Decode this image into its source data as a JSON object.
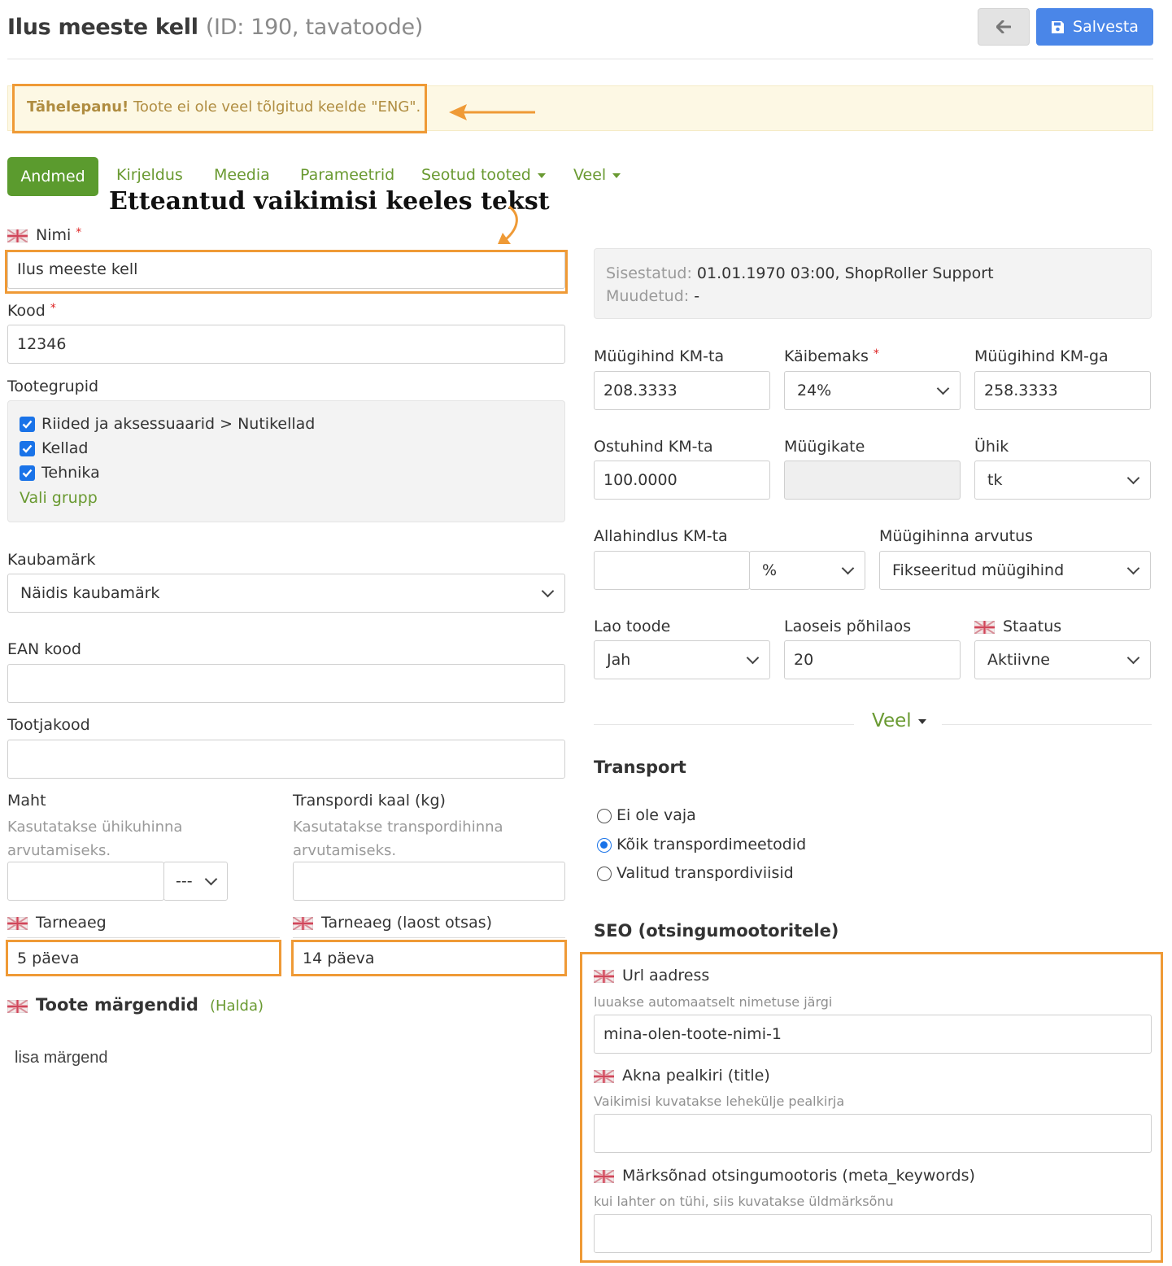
{
  "header": {
    "title": "Ilus meeste kell",
    "subtitle": "(ID: 190, tavatoode)",
    "save_label": "Salvesta"
  },
  "alert": {
    "strong": "Tähelepanu!",
    "text": " Toote ei ole veel tõlgitud keelde \"ENG\"."
  },
  "tabs": [
    {
      "label": "Andmed"
    },
    {
      "label": "Kirjeldus"
    },
    {
      "label": "Meedia"
    },
    {
      "label": "Parameetrid"
    },
    {
      "label": "Seotud tooted"
    },
    {
      "label": "Veel"
    }
  ],
  "annotation": "Etteantud vaikimisi keeles tekst",
  "left": {
    "name_label": "Nimi",
    "name_value": "Ilus meeste kell",
    "code_label": "Kood",
    "code_value": "12346",
    "groups_label": "Tootegrupid",
    "groups": [
      "Riided ja aksessuaarid > Nutikellad",
      "Kellad",
      "Tehnika"
    ],
    "choose_group": "Vali grupp",
    "brand_label": "Kaubamärk",
    "brand_value": "Näidis kaubamärk",
    "ean_label": "EAN kood",
    "ean_value": "",
    "maker_label": "Tootjakood",
    "maker_value": "",
    "volume_label": "Maht",
    "volume_hint": "Kasutatakse ühikuhinna arvutamiseks.",
    "volume_unit": "---",
    "weight_label": "Transpordi kaal (kg)",
    "weight_hint": "Kasutatakse transpordihinna arvutamiseks.",
    "delivery_label": "Tarneaeg",
    "delivery_value": "5 päeva",
    "delivery_stock_label": "Tarneaeg (laost otsas)",
    "delivery_stock_value": "14 päeva",
    "tags_title": "Toote märgendid",
    "tags_manage": "(Halda)",
    "add_tag": "lisa märgend"
  },
  "right": {
    "info_created_label": "Sisestatud:",
    "info_created_value": " 01.01.1970 03:00, ShopRoller Support",
    "info_modified_label": "Muudetud:",
    "info_modified_value": " -",
    "price_excl_label": "Müügihind KM-ta",
    "price_excl_value": "208.3333",
    "vat_label": "Käibemaks",
    "vat_value": "24%",
    "price_incl_label": "Müügihind KM-ga",
    "price_incl_value": "258.3333",
    "purchase_label": "Ostuhind KM-ta",
    "purchase_value": "100.0000",
    "margin_label": "Müügikate",
    "unit_label": "Ühik",
    "unit_value": "tk",
    "discount_label": "Allahindlus KM-ta",
    "discount_unit": "%",
    "calc_label": "Müügihinna arvutus",
    "calc_value": "Fikseeritud müügihind",
    "stock_item_label": "Lao toode",
    "stock_item_value": "Jah",
    "stock_main_label": "Laoseis põhilaos",
    "stock_main_value": "20",
    "status_label": "Staatus",
    "status_value": "Aktiivne",
    "more_label": "Veel",
    "transport_title": "Transport",
    "transport_options": [
      "Ei ole vaja",
      "Kõik transpordimeetodid",
      "Valitud transpordiviisid"
    ],
    "seo_title": "SEO (otsingumootoritele)",
    "url_label": "Url aadress",
    "url_hint": "luuakse automaatselt nimetuse järgi",
    "url_value": "mina-olen-toote-nimi-1",
    "title_label": "Akna pealkiri (title)",
    "title_hint": "Vaikimisi kuvatakse lehekülje pealkirja",
    "keywords_label": "Märksõnad otsingumootoris (meta_keywords)",
    "keywords_hint": "kui lahter on tühi, siis kuvatakse üldmärksõnu"
  },
  "colors": {
    "accent_green": "#5b9b2e",
    "save_blue": "#4a86e8",
    "highlight_orange": "#ef9a36",
    "alert_bg": "#fdf8e4"
  }
}
